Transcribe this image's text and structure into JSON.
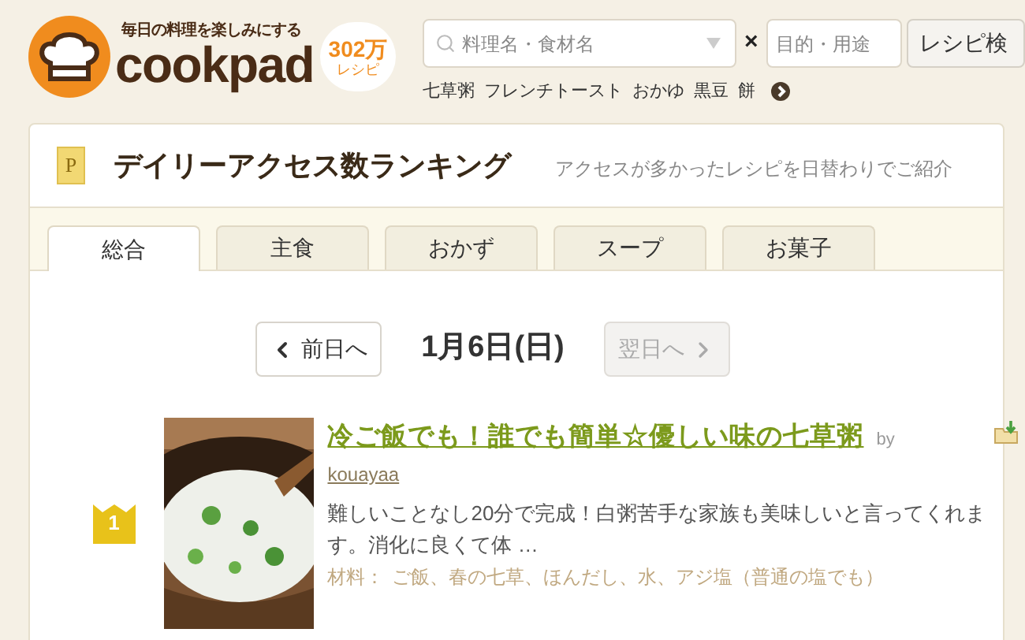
{
  "logo": {
    "tagline": "毎日の料理を楽しみにする",
    "wordmark": "cookpad",
    "count": "302万",
    "count_unit": "レシピ"
  },
  "search": {
    "placeholder": "料理名・食材名",
    "joiner": "×",
    "purpose_placeholder": "目的・用途",
    "button": "レシピ検"
  },
  "keywords": [
    "七草粥",
    "フレンチトースト",
    "おかゆ",
    "黒豆",
    "餅"
  ],
  "panel": {
    "badge": "P",
    "title": "デイリーアクセス数ランキング",
    "subtitle": "アクセスが多かったレシピを日替わりでご紹介"
  },
  "tabs": [
    {
      "label": "総合",
      "selected": true
    },
    {
      "label": "主食",
      "selected": false
    },
    {
      "label": "おかず",
      "selected": false
    },
    {
      "label": "スープ",
      "selected": false
    },
    {
      "label": "お菓子",
      "selected": false
    }
  ],
  "date_nav": {
    "prev": {
      "label": "前日へ",
      "disabled": false
    },
    "date": "1月6日(日)",
    "next": {
      "label": "翌日へ",
      "disabled": true
    }
  },
  "recipes": [
    {
      "rank": "1",
      "title": "冷ご飯でも！誰でも簡単☆優しい味の七草粥",
      "by": "by",
      "author": "kouayaa",
      "description": "難しいことなし20分で完成！白粥苦手な家族も美味しいと言ってくれます。消化に良くて体 …",
      "ingredients_label": "材料：",
      "ingredients": "ご飯、春の七草、ほんだし、水、アジ塩（普通の塩でも）"
    }
  ]
}
